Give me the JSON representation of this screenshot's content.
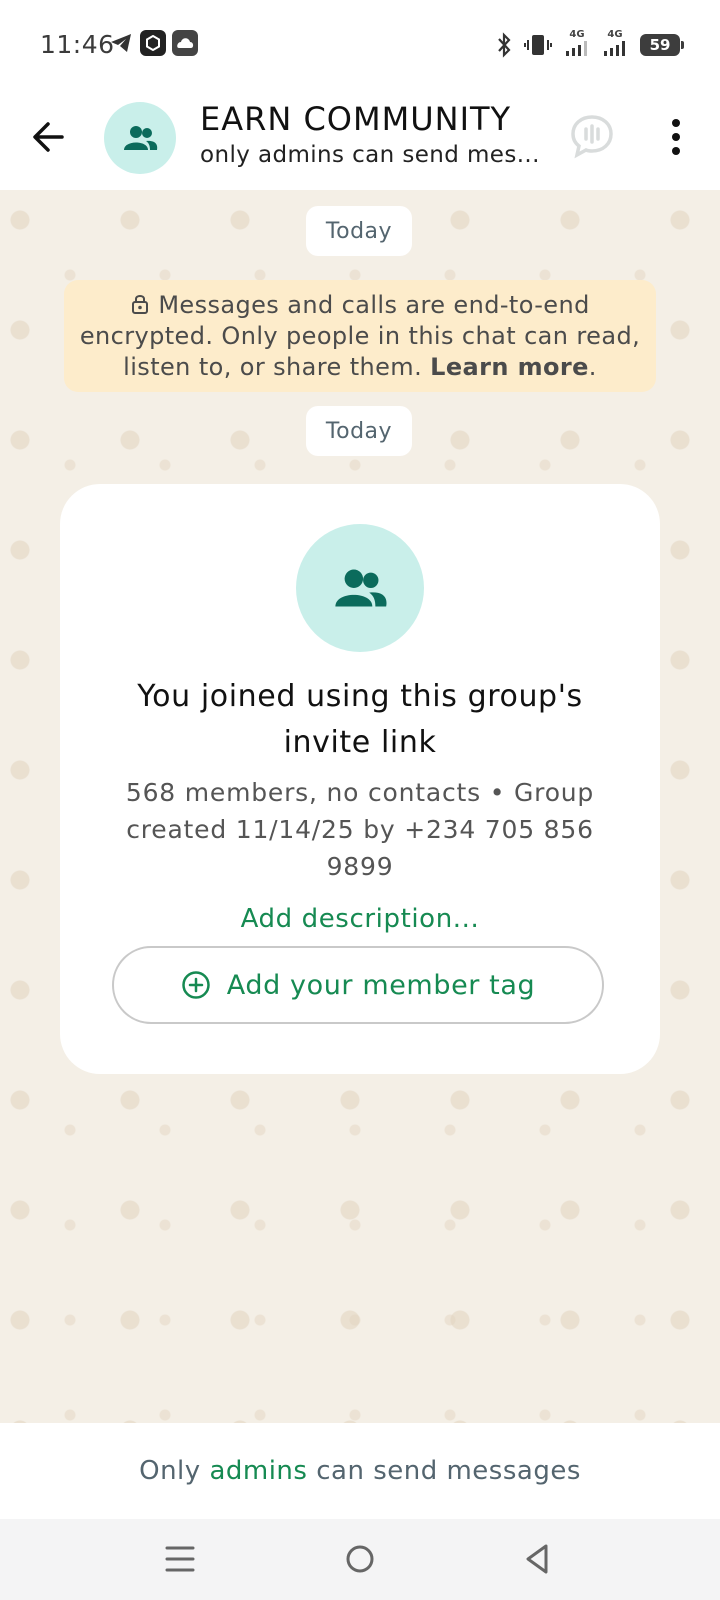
{
  "status_bar": {
    "time": "11:46",
    "battery": "59",
    "network_1": "4G",
    "network_2": "4G",
    "icons": [
      "telegram-icon",
      "app-icon",
      "cloud-icon",
      "bluetooth-icon",
      "vibrate-icon",
      "signal-icon",
      "signal-icon",
      "battery-icon"
    ]
  },
  "header": {
    "title": "EARN COMMUNITY",
    "subtitle": "only admins can send mes...",
    "icons": [
      "back-arrow-icon",
      "group-avatar-icon",
      "voice-chat-icon",
      "more-vert-icon"
    ]
  },
  "chat": {
    "date_chip_1": "Today",
    "encryption_notice": "Messages and calls are end-to-end encrypted. Only people in this chat can read, listen to, or share them.",
    "learn_more": "Learn more",
    "learn_more_suffix": ".",
    "date_chip_2": "Today",
    "card": {
      "title": "You joined using this group's invite link",
      "info": "568 members, no contacts • Group created 11/14/25 by +234 705 856 9899",
      "add_description": "Add description...",
      "member_tag_button": "Add your member tag"
    }
  },
  "footer": {
    "text_before": "Only",
    "link": "admins",
    "text_after": "can send messages"
  },
  "nav_bar": {
    "icons": [
      "menu-icon",
      "home-circle-icon",
      "back-triangle-icon"
    ]
  },
  "colors": {
    "accent_green": "#168a52",
    "avatar_bg": "#c9efea",
    "avatar_fg": "#0b6b5c",
    "chat_bg": "#f4efe6",
    "encryption_bg": "#fdeccb"
  }
}
